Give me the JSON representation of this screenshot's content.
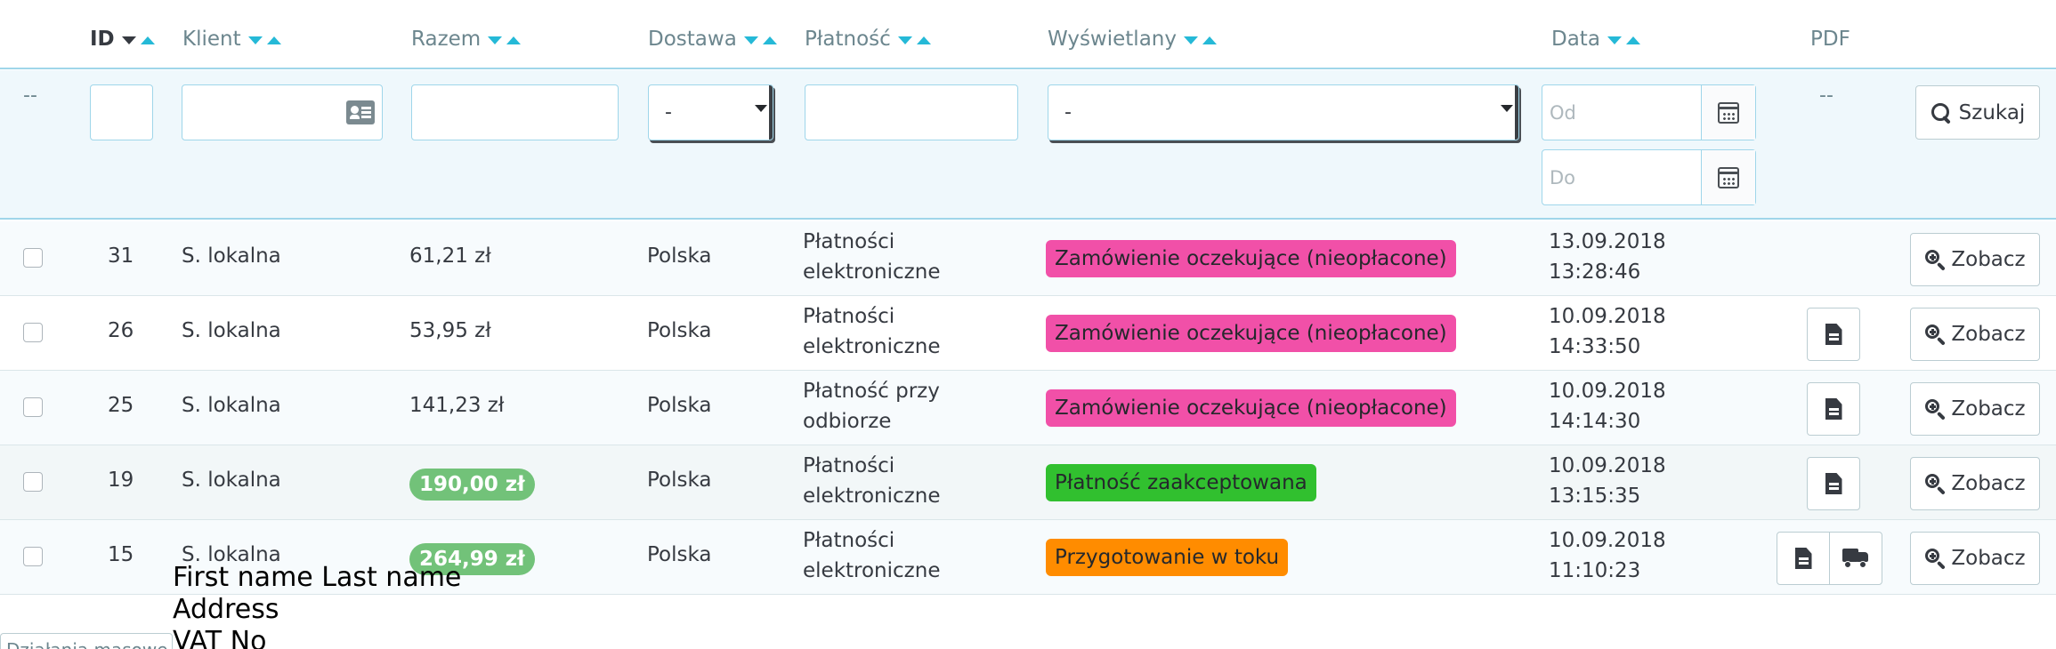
{
  "headers": {
    "id": "ID",
    "client": "Klient",
    "total": "Razem",
    "delivery": "Dostawa",
    "payment": "Płatność",
    "status": "Wyświetlany",
    "date": "Data",
    "pdf": "PDF"
  },
  "filters": {
    "select_dash": "--",
    "delivery_value": "-",
    "status_value": "-",
    "date_from_placeholder": "Od",
    "date_to_placeholder": "Do",
    "pdf_dash": "--",
    "search_label": "Szukaj"
  },
  "rows": [
    {
      "id": "31",
      "client": "S. lokalna",
      "total": "61,21 zł",
      "total_highlight": false,
      "delivery": "Polska",
      "payment_line1": "Płatności",
      "payment_line2": "elektroniczne",
      "status": "Zamówienie oczekujące (nieopłacone)",
      "status_color": "#f150a8",
      "date": "13.09.2018",
      "time": "13:28:46",
      "view_label": "Zobacz"
    },
    {
      "id": "26",
      "client": "S. lokalna",
      "total": "53,95 zł",
      "total_highlight": false,
      "delivery": "Polska",
      "payment_line1": "Płatności",
      "payment_line2": "elektroniczne",
      "status": "Zamówienie oczekujące (nieopłacone)",
      "status_color": "#f150a8",
      "date": "10.09.2018",
      "time": "14:33:50",
      "view_label": "Zobacz"
    },
    {
      "id": "25",
      "client": "S. lokalna",
      "total": "141,23 zł",
      "total_highlight": false,
      "delivery": "Polska",
      "payment_line1": "Płatność przy",
      "payment_line2": "odbiorze",
      "status": "Zamówienie oczekujące (nieopłacone)",
      "status_color": "#f150a8",
      "date": "10.09.2018",
      "time": "14:14:30",
      "view_label": "Zobacz"
    },
    {
      "id": "19",
      "client": "S. lokalna",
      "total": "190,00 zł",
      "total_highlight": true,
      "delivery": "Polska",
      "payment_line1": "Płatności",
      "payment_line2": "elektroniczne",
      "status": "Płatność zaakceptowana",
      "status_color": "#31c02f",
      "date": "10.09.2018",
      "time": "13:15:35",
      "view_label": "Zobacz"
    },
    {
      "id": "15",
      "client": "S. lokalna",
      "total": "264,99 zł",
      "total_highlight": true,
      "delivery": "Polska",
      "payment_line1": "Płatności",
      "payment_line2": "elektroniczne",
      "status": "Przygotowanie w toku",
      "status_color": "#ff8c00",
      "date": "10.09.2018",
      "time": "11:10:23",
      "view_label": "Zobacz"
    }
  ],
  "tooltip": {
    "line1": "First name Last name",
    "line2": "Address",
    "line3": "VAT No"
  },
  "bulk_actions": {
    "label": "Działania masowe"
  },
  "icons": [
    "sort-desc-icon",
    "sort-asc-icon",
    "id-card-icon",
    "calendar-icon",
    "search-icon",
    "zoom-in-icon",
    "document-icon",
    "truck-icon"
  ]
}
